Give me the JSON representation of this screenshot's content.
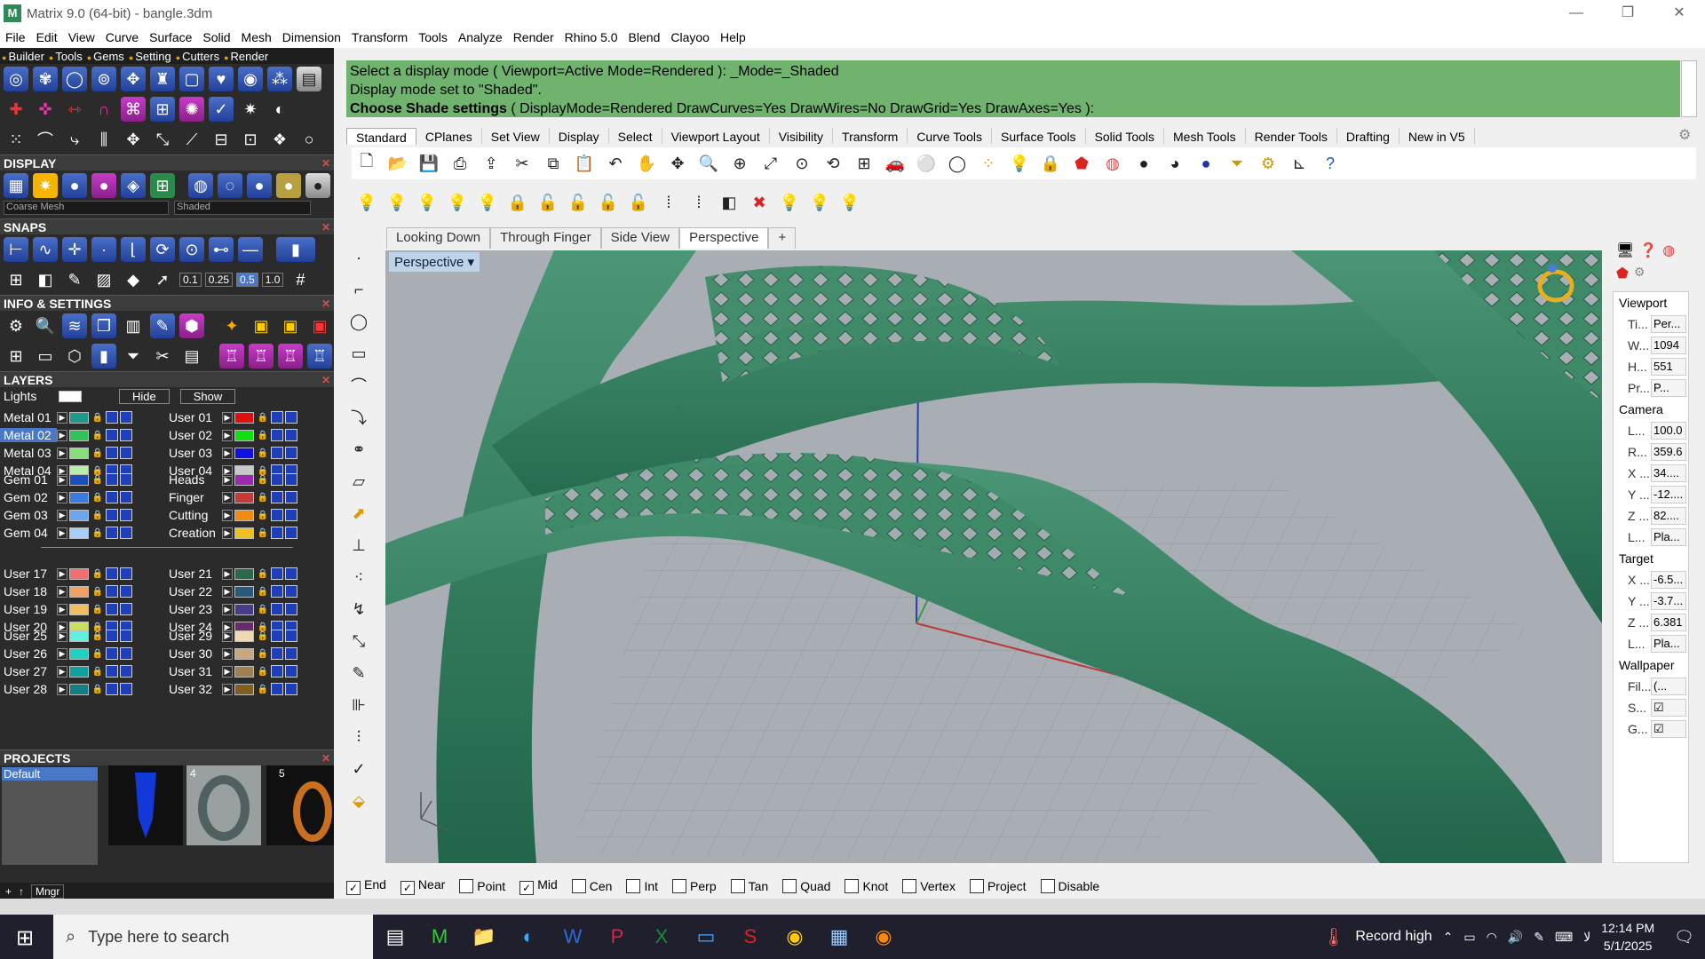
{
  "window": {
    "title": "Matrix 9.0 (64-bit) - bangle.3dm",
    "min": "—",
    "max": "❐",
    "close": "✕"
  },
  "menu": [
    "File",
    "Edit",
    "View",
    "Curve",
    "Surface",
    "Solid",
    "Mesh",
    "Dimension",
    "Transform",
    "Tools",
    "Analyze",
    "Render",
    "Rhino 5.0",
    "Blend",
    "Clayoo",
    "Help"
  ],
  "matrix_tabs": [
    "Builder",
    "Tools",
    "Gems",
    "Setting",
    "Cutters",
    "Render"
  ],
  "sections": {
    "display": "DISPLAY",
    "snaps": "SNAPS",
    "info": "INFO & SETTINGS",
    "layers": "LAYERS",
    "projects": "PROJECTS"
  },
  "display": {
    "mesh": "Coarse Mesh",
    "mode": "Shaded"
  },
  "snaps_values": [
    "0.1",
    "0.25",
    "0.5",
    "1.0"
  ],
  "layers": {
    "lights": "Lights",
    "hide": "Hide",
    "show": "Show",
    "groupA_left": [
      {
        "name": "Metal 01",
        "color": "#1f9a8a"
      },
      {
        "name": "Metal 02",
        "color": "#2ec45a",
        "selected": true
      },
      {
        "name": "Metal 03",
        "color": "#86e07a"
      },
      {
        "name": "Metal 04",
        "color": "#b8f0a8"
      }
    ],
    "groupA_right": [
      {
        "name": "User 01",
        "color": "#e01010"
      },
      {
        "name": "User 02",
        "color": "#10e010"
      },
      {
        "name": "User 03",
        "color": "#1010e0"
      },
      {
        "name": "User 04",
        "color": "#c8c8c8"
      }
    ],
    "groupB_left": [
      {
        "name": "Gem 01",
        "color": "#1c4fb8"
      },
      {
        "name": "Gem 02",
        "color": "#3a7be0"
      },
      {
        "name": "Gem 03",
        "color": "#6aa7f0"
      },
      {
        "name": "Gem 04",
        "color": "#a6cef8"
      }
    ],
    "groupB_right": [
      {
        "name": "Heads",
        "color": "#9a2ab0"
      },
      {
        "name": "Finger",
        "color": "#c83a3a"
      },
      {
        "name": "Cutting",
        "color": "#f08a10"
      },
      {
        "name": "Creation",
        "color": "#f0c020"
      }
    ],
    "groupC_left": [
      {
        "name": "User 17",
        "color": "#f07070"
      },
      {
        "name": "User 18",
        "color": "#f0a060"
      },
      {
        "name": "User 19",
        "color": "#f0c060"
      },
      {
        "name": "User 20",
        "color": "#c8e060"
      }
    ],
    "groupC_right": [
      {
        "name": "User 21",
        "color": "#2a6a4a"
      },
      {
        "name": "User 22",
        "color": "#2a5a7a"
      },
      {
        "name": "User 23",
        "color": "#4a3a8a"
      },
      {
        "name": "User 24",
        "color": "#6a2a6a"
      }
    ],
    "groupD_left": [
      {
        "name": "User 25",
        "color": "#60f0e0"
      },
      {
        "name": "User 26",
        "color": "#20d0c0"
      },
      {
        "name": "User 27",
        "color": "#10a0a0"
      },
      {
        "name": "User 28",
        "color": "#108080"
      }
    ],
    "groupD_right": [
      {
        "name": "User 29",
        "color": "#f0d8b0"
      },
      {
        "name": "User 30",
        "color": "#c8a880"
      },
      {
        "name": "User 31",
        "color": "#a08050"
      },
      {
        "name": "User 32",
        "color": "#806020"
      }
    ]
  },
  "projects": {
    "default": "Default",
    "tile_numbers": [
      "4",
      "5"
    ],
    "mngr": "Mngr"
  },
  "command": {
    "line1": "Select a display mode ( Viewport=Active  Mode=Rendered ): _Mode=_Shaded",
    "line2": "Display mode set to \"Shaded\".",
    "line3_bold": "Choose Shade settings",
    "line3_rest": "( DisplayMode=Rendered  DrawCurves=Yes  DrawWires=No  DrawGrid=Yes  DrawAxes=Yes ):"
  },
  "toolbar_tabs": [
    "Standard",
    "CPlanes",
    "Set View",
    "Display",
    "Select",
    "Viewport Layout",
    "Visibility",
    "Transform",
    "Curve Tools",
    "Surface Tools",
    "Solid Tools",
    "Mesh Tools",
    "Render Tools",
    "Drafting",
    "New in V5"
  ],
  "viewport_tabs": [
    "Looking Down",
    "Through Finger",
    "Side View",
    "Perspective",
    "+"
  ],
  "viewport_title": "Perspective",
  "properties": {
    "viewport_h": "Viewport",
    "viewport": [
      {
        "k": "Ti...",
        "v": "Per..."
      },
      {
        "k": "W...",
        "v": "1094"
      },
      {
        "k": "H...",
        "v": "551"
      },
      {
        "k": "Pr...",
        "v": "P..."
      }
    ],
    "camera_h": "Camera",
    "camera": [
      {
        "k": "L...",
        "v": "100.0"
      },
      {
        "k": "R...",
        "v": "359.6"
      },
      {
        "k": "X ...",
        "v": "34...."
      },
      {
        "k": "Y ...",
        "v": "-12...."
      },
      {
        "k": "Z ...",
        "v": "82...."
      },
      {
        "k": "L...",
        "v": "Pla..."
      }
    ],
    "target_h": "Target",
    "target": [
      {
        "k": "X ...",
        "v": "-6.5..."
      },
      {
        "k": "Y ...",
        "v": "-3.7..."
      },
      {
        "k": "Z ...",
        "v": "6.381"
      },
      {
        "k": "L...",
        "v": "Pla..."
      }
    ],
    "wallpaper_h": "Wallpaper",
    "wallpaper": [
      {
        "k": "Fil...",
        "v": "(..."
      },
      {
        "k": "S...",
        "v": "☑"
      },
      {
        "k": "G...",
        "v": "☑"
      }
    ]
  },
  "osnaps": [
    {
      "label": "End",
      "checked": true
    },
    {
      "label": "Near",
      "checked": true
    },
    {
      "label": "Point",
      "checked": false
    },
    {
      "label": "Mid",
      "checked": true
    },
    {
      "label": "Cen",
      "checked": false
    },
    {
      "label": "Int",
      "checked": false
    },
    {
      "label": "Perp",
      "checked": false
    },
    {
      "label": "Tan",
      "checked": false
    },
    {
      "label": "Quad",
      "checked": false
    },
    {
      "label": "Knot",
      "checked": false
    },
    {
      "label": "Vertex",
      "checked": false
    },
    {
      "label": "Project",
      "checked": false
    },
    {
      "label": "Disable",
      "checked": false
    }
  ],
  "taskbar": {
    "search_placeholder": "Type here to search",
    "weather": "Record high",
    "time": "12:14 PM",
    "date": "5/1/2025",
    "lang": "ﻟﺎ"
  }
}
